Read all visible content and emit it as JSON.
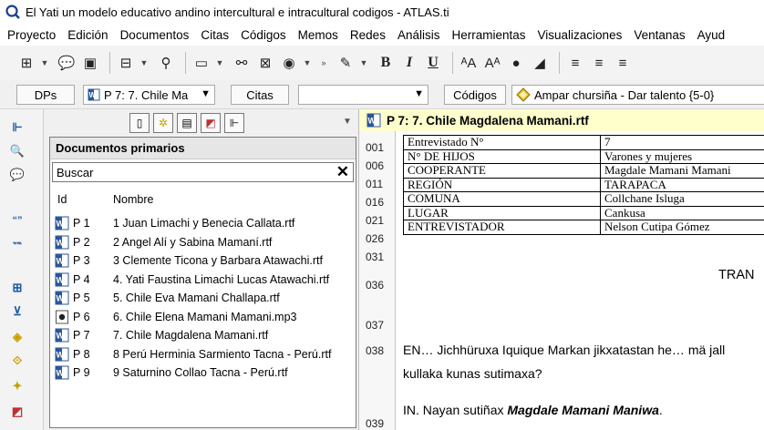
{
  "window": {
    "title": "El Yati un modelo educativo andino intercultural e intracultural codigos - ATLAS.ti",
    "app_icon": "atlas-ti-icon"
  },
  "menu": [
    "Proyecto",
    "Edición",
    "Documentos",
    "Citas",
    "Códigos",
    "Memos",
    "Redes",
    "Análisis",
    "Herramientas",
    "Visualizaciones",
    "Ventanas",
    "Ayud"
  ],
  "toolbar": {
    "bold": "B",
    "italic": "I",
    "underline": "U",
    "more": "»"
  },
  "selectors": {
    "dps_label": "DPs",
    "doc_combo": "P 7: 7. Chile Ma",
    "citas_label": "Citas",
    "citas_combo": "",
    "codigos_label": "Códigos",
    "codigos_combo": "Ampar chursiña - Dar talento {5-0}"
  },
  "docs_panel": {
    "header": "Documentos primarios",
    "search_placeholder": "Buscar",
    "col_id": "Id",
    "col_name": "Nombre",
    "rows": [
      {
        "id": "P 1",
        "name": "1 Juan Limachi y Benecia Callata.rtf",
        "type": "word"
      },
      {
        "id": "P 2",
        "name": "2 Angel Alí y Sabina Mamaní.rtf",
        "type": "word"
      },
      {
        "id": "P 3",
        "name": "3 Clemente Ticona y Barbara Atawachi.rtf",
        "type": "word"
      },
      {
        "id": "P 4",
        "name": "4. Yati  Faustina Limachi Lucas Atawachi.rtf",
        "type": "word"
      },
      {
        "id": "P 5",
        "name": "5. Chile  Eva Mamani Challapa.rtf",
        "type": "word"
      },
      {
        "id": "P 6",
        "name": "6. Chile Elena Mamani Mamani.mp3",
        "type": "audio"
      },
      {
        "id": "P 7",
        "name": "7. Chile Magdalena Mamani.rtf",
        "type": "word"
      },
      {
        "id": "P 8",
        "name": "8 Perú Herminia Sarmiento Tacna - Perú.rtf",
        "type": "word"
      },
      {
        "id": "P 9",
        "name": "9 Saturnino Collao Tacna - Perú.rtf",
        "type": "word"
      }
    ]
  },
  "document": {
    "title": "P 7: 7. Chile Magdalena Mamani.rtf",
    "line_numbers": [
      "001",
      "006",
      "011",
      "016",
      "021",
      "026",
      "031",
      "036",
      "037",
      "038",
      "039"
    ],
    "table": [
      [
        "Entrevistado N°",
        "7"
      ],
      [
        "N° DE HIJOS",
        "Varones y mujeres"
      ],
      [
        "COOPERANTE",
        "Magdale Mamani Mamani"
      ],
      [
        "REGIÓN",
        "TARAPACA"
      ],
      [
        "COMUNA",
        "Collchane Isluga"
      ],
      [
        "LUGAR",
        "Cankusa"
      ],
      [
        "ENTREVISTADOR",
        "Nelson Cutipa Gómez"
      ]
    ],
    "tran": "TRAN",
    "p1_line1": "EN… Jichhüruxa  Iquique Markan jikxatastan he… mä jall",
    "p1_line2": "kullaka  kunas sutimaxa?",
    "p2_prefix": "IN. Nayan sutiñax ",
    "p2_bold": "Magdale  Mamani Maniwa",
    "p2_suffix": "."
  }
}
